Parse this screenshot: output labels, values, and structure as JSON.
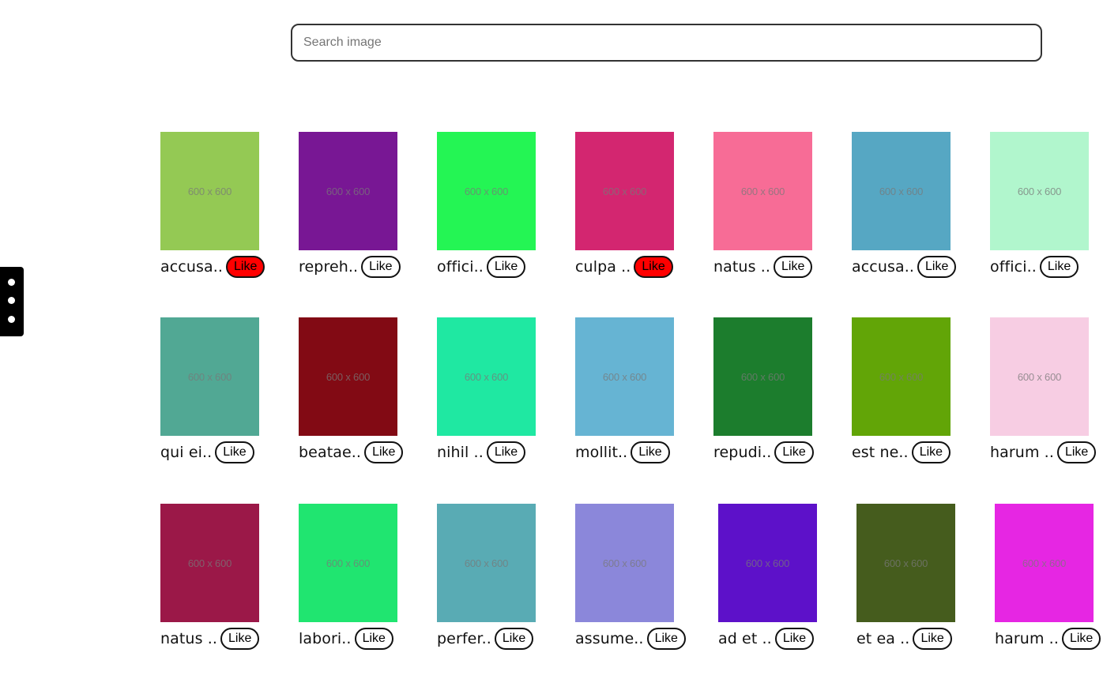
{
  "search": {
    "placeholder": "Search image",
    "value": ""
  },
  "side_menu": {
    "icon": "vertical-dots-icon"
  },
  "gallery": {
    "items": [
      {
        "title": "accusa..",
        "like_label": "Like",
        "liked": true,
        "color": "#94c954",
        "image_text": "600 x 600"
      },
      {
        "title": "repreh..",
        "like_label": "Like",
        "liked": false,
        "color": "#781794",
        "image_text": "600 x 600"
      },
      {
        "title": "offici..",
        "like_label": "Like",
        "liked": false,
        "color": "#24f554",
        "image_text": "600 x 600"
      },
      {
        "title": "culpa ..",
        "like_label": "Like",
        "liked": true,
        "color": "#d32670",
        "image_text": "600 x 600"
      },
      {
        "title": "natus ..",
        "like_label": "Like",
        "liked": false,
        "color": "#f76c96",
        "image_text": "600 x 600"
      },
      {
        "title": "accusa..",
        "like_label": "Like",
        "liked": false,
        "color": "#56a7c3",
        "image_text": "600 x 600"
      },
      {
        "title": "offici..",
        "like_label": "Like",
        "liked": false,
        "color": "#b1f6cd",
        "image_text": "600 x 600"
      },
      {
        "title": "qui ei..",
        "like_label": "Like",
        "liked": false,
        "color": "#51a894",
        "image_text": "600 x 600"
      },
      {
        "title": "beatae..",
        "like_label": "Like",
        "liked": false,
        "color": "#820a14",
        "image_text": "600 x 600"
      },
      {
        "title": "nihil ..",
        "like_label": "Like",
        "liked": false,
        "color": "#1fe8a2",
        "image_text": "600 x 600"
      },
      {
        "title": "mollit..",
        "like_label": "Like",
        "liked": false,
        "color": "#66b4d3",
        "image_text": "600 x 600"
      },
      {
        "title": "repudi..",
        "like_label": "Like",
        "liked": false,
        "color": "#1c7d2d",
        "image_text": "600 x 600"
      },
      {
        "title": "est ne..",
        "like_label": "Like",
        "liked": false,
        "color": "#62a507",
        "image_text": "600 x 600"
      },
      {
        "title": "harum ..",
        "like_label": "Like",
        "liked": false,
        "color": "#f7cde3",
        "image_text": "600 x 600"
      },
      {
        "title": "natus ..",
        "like_label": "Like",
        "liked": false,
        "color": "#9b1848",
        "image_text": "600 x 600"
      },
      {
        "title": "labori..",
        "like_label": "Like",
        "liked": false,
        "color": "#20e570",
        "image_text": "600 x 600"
      },
      {
        "title": "perfer..",
        "like_label": "Like",
        "liked": false,
        "color": "#59abb4",
        "image_text": "600 x 600"
      },
      {
        "title": "assume..",
        "like_label": "Like",
        "liked": false,
        "color": "#8b87da",
        "image_text": "600 x 600"
      },
      {
        "title": "ad et ..",
        "like_label": "Like",
        "liked": false,
        "color": "#5d11c9",
        "image_text": "600 x 600"
      },
      {
        "title": "et ea ..",
        "like_label": "Like",
        "liked": false,
        "color": "#455c1d",
        "image_text": "600 x 600"
      },
      {
        "title": "harum ..",
        "like_label": "Like",
        "liked": false,
        "color": "#e626e3",
        "image_text": "600 x 600"
      }
    ]
  }
}
